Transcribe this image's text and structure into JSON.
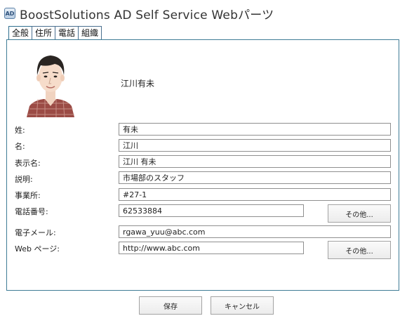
{
  "window": {
    "title": "BoostSolutions AD Self Service Webパーツ",
    "icon": "AD"
  },
  "tabs": [
    {
      "label": "全般",
      "active": true
    },
    {
      "label": "住所",
      "active": false
    },
    {
      "label": "電話",
      "active": false
    },
    {
      "label": "組織",
      "active": false
    }
  ],
  "profile": {
    "display_name": "江川有未"
  },
  "fields": {
    "last_name": {
      "label": "姓:",
      "value": "有未"
    },
    "first_name": {
      "label": "名:",
      "value": "江川"
    },
    "display_name": {
      "label": "表示名:",
      "value": "江川 有未"
    },
    "description": {
      "label": "説明:",
      "value": "市場部のスタッフ"
    },
    "office": {
      "label": "事業所:",
      "value": "#27-1"
    },
    "phone": {
      "label": "電話番号:",
      "value": "62533884",
      "other_button": "その他..."
    },
    "email": {
      "label": "電子メール:",
      "value": "rgawa_yuu@abc.com"
    },
    "web_page": {
      "label": "Web ページ:",
      "value": "http://www.abc.com",
      "other_button": "その他..."
    }
  },
  "actions": {
    "save": "保存",
    "cancel": "キャンセル"
  },
  "colors": {
    "panel_border": "#3f7c96",
    "tab_border": "#4a6f8f"
  }
}
